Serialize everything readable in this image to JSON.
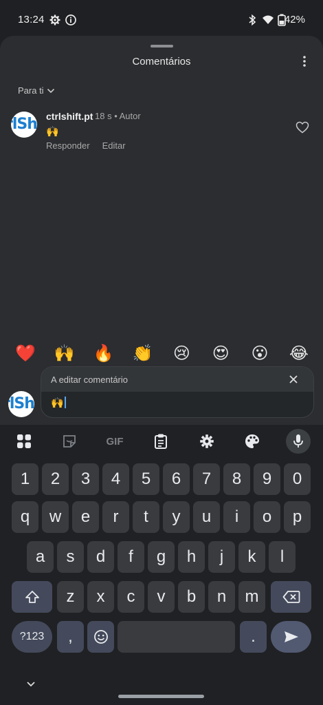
{
  "status_bar": {
    "time": "13:24",
    "battery": "42%",
    "icons": [
      "settings-icon",
      "info-icon",
      "bluetooth-icon",
      "wifi-icon",
      "battery-icon"
    ]
  },
  "sheet": {
    "title": "Comentários",
    "sort_label": "Para ti"
  },
  "comment": {
    "avatar_text": "rlSh",
    "author": "ctrlshift.pt",
    "time": "18 s",
    "role": "Autor",
    "body": "🙌",
    "reply_label": "Responder",
    "edit_label": "Editar"
  },
  "emoji_bar": [
    "❤️",
    "🙌",
    "🔥",
    "👏",
    "😢",
    "😍",
    "😮",
    "😂"
  ],
  "composer": {
    "avatar_text": "rlSh",
    "editing_label": "A editar comentário",
    "value": "🙌"
  },
  "keyboard": {
    "toolbar": [
      "apps-grid-icon",
      "sticker-icon",
      "GIF",
      "clipboard-icon",
      "settings-icon",
      "palette-icon",
      "mic-icon"
    ],
    "row_numbers": [
      "1",
      "2",
      "3",
      "4",
      "5",
      "6",
      "7",
      "8",
      "9",
      "0"
    ],
    "row_top": [
      "q",
      "w",
      "e",
      "r",
      "t",
      "y",
      "u",
      "i",
      "o",
      "p"
    ],
    "row_middle": [
      "a",
      "s",
      "d",
      "f",
      "g",
      "h",
      "j",
      "k",
      "l"
    ],
    "row_bottom": [
      "z",
      "x",
      "c",
      "v",
      "b",
      "n",
      "m"
    ],
    "symbols_label": "?123",
    "comma": ",",
    "period": ".",
    "space_label": ""
  },
  "colors": {
    "background": "#1f2023",
    "sheet": "#2b2d30",
    "key": "#3a3b3f",
    "modifier_key": "#444a5b",
    "accent_caret": "#5aa6f0"
  }
}
